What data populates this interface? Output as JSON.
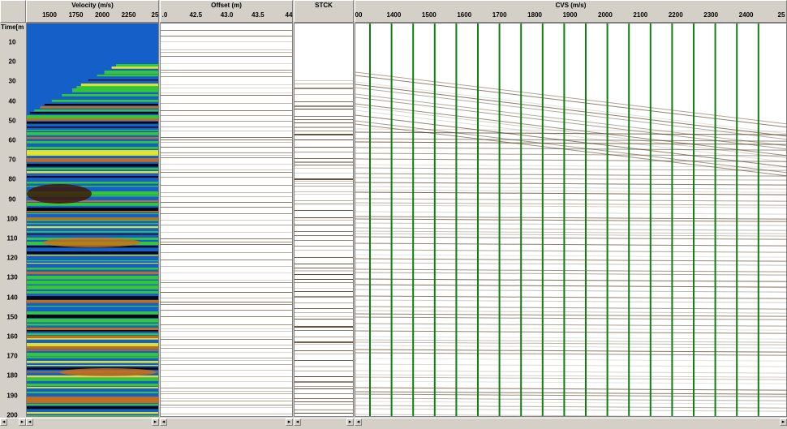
{
  "time_axis": {
    "label": "Time[m",
    "ticks": [
      "10",
      "20",
      "30",
      "40",
      "50",
      "60",
      "70",
      "80",
      "90",
      "100",
      "110",
      "120",
      "130",
      "140",
      "150",
      "160",
      "170",
      "180",
      "190",
      "200"
    ]
  },
  "velocity_panel": {
    "title": "Velocity (m/s)",
    "ticks": [
      "1500",
      "1750",
      "2000",
      "2250",
      "25"
    ],
    "colors": {
      "background": "#1560c8",
      "green": "#3ad02a",
      "yellow": "#f0f020",
      "orange": "#d07010",
      "dark": "#401000",
      "black": "#000000"
    }
  },
  "offset_panel": {
    "title": "Offset (m)",
    "ticks": [
      ".0",
      "42.5",
      "43.0",
      "43.5",
      "44"
    ]
  },
  "stck_panel": {
    "title": "STCK"
  },
  "cvs_panel": {
    "title": "CVS (m/s)",
    "ticks": [
      "00",
      "1400",
      "1500",
      "1600",
      "1700",
      "1800",
      "1900",
      "2000",
      "2100",
      "2200",
      "2300",
      "2400",
      "25"
    ],
    "line_color": "#108010"
  },
  "icons": {
    "scroll_left": "left-arrow-icon",
    "scroll_right": "right-arrow-icon"
  }
}
